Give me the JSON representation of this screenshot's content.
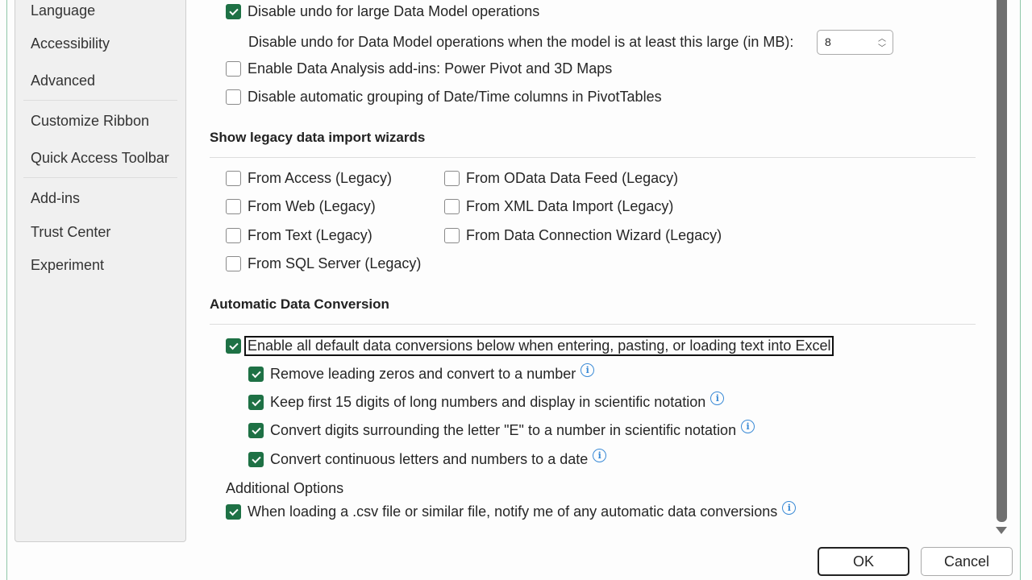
{
  "sidebar": {
    "items": [
      {
        "label": "Language"
      },
      {
        "label": "Accessibility"
      },
      {
        "label": "Advanced"
      },
      {
        "label": "Customize Ribbon"
      },
      {
        "label": "Quick Access Toolbar"
      },
      {
        "label": "Add-ins"
      },
      {
        "label": "Trust Center"
      },
      {
        "label": "Experiment"
      }
    ]
  },
  "data": {
    "disable_undo": {
      "label": "Disable undo for large Data Model operations",
      "checked": true
    },
    "undo_size": {
      "label": "Disable undo for Data Model operations when the model is at least this large (in MB):",
      "value": "8"
    },
    "enable_addins": {
      "label": "Enable Data Analysis add-ins: Power Pivot and 3D Maps",
      "checked": false
    },
    "disable_grouping": {
      "label": "Disable automatic grouping of Date/Time columns in PivotTables",
      "checked": false
    }
  },
  "legacy": {
    "title": "Show legacy data import wizards",
    "items": [
      {
        "label": "From Access (Legacy)",
        "checked": false
      },
      {
        "label": "From Web (Legacy)",
        "checked": false
      },
      {
        "label": "From Text (Legacy)",
        "checked": false
      },
      {
        "label": "From SQL Server (Legacy)",
        "checked": false
      },
      {
        "label": "From OData Data Feed (Legacy)",
        "checked": false
      },
      {
        "label": "From XML Data Import (Legacy)",
        "checked": false
      },
      {
        "label": "From Data Connection Wizard (Legacy)",
        "checked": false
      }
    ]
  },
  "conversion": {
    "title": "Automatic Data Conversion",
    "enable_all": {
      "label": "Enable all default data conversions below when entering, pasting, or loading text into Excel",
      "checked": true
    },
    "items": [
      {
        "label": "Remove leading zeros and convert to a number",
        "checked": true
      },
      {
        "label": "Keep first 15 digits of long numbers and display in scientific notation",
        "checked": true
      },
      {
        "label": "Convert digits surrounding the letter \"E\" to a number in scientific notation",
        "checked": true
      },
      {
        "label": "Convert continuous letters and numbers to a date",
        "checked": true
      }
    ],
    "additional_title": "Additional Options",
    "csv_notify": {
      "label": "When loading a .csv file or similar file, notify me of any automatic data conversions",
      "checked": true
    }
  },
  "buttons": {
    "ok": "OK",
    "cancel": "Cancel"
  },
  "colors": {
    "accent": "#1e7145",
    "info": "#3a8ad6"
  }
}
